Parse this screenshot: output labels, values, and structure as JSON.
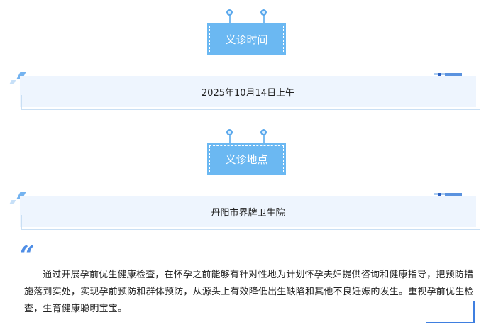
{
  "sections": [
    {
      "title": "义诊时间",
      "content": "2025年10月14日上午"
    },
    {
      "title": "义诊地点",
      "content": "丹阳市界牌卫生院"
    }
  ],
  "description": {
    "quote_mark": "“",
    "text": "通过开展孕前优生健康检查，在怀孕之前能够有针对性地为计划怀孕夫妇提供咨询和健康指导，把预防措施落到实处，实现孕前预防和群体预防，从源头上有效降低出生缺陷和其他不良妊娠的发生。重视孕前优生检查，生育健康聪明宝宝。"
  },
  "colors": {
    "tag_background": "#6bb8f2",
    "card_background": "#eef5fe",
    "accent_blue": "#3f7fe0"
  }
}
